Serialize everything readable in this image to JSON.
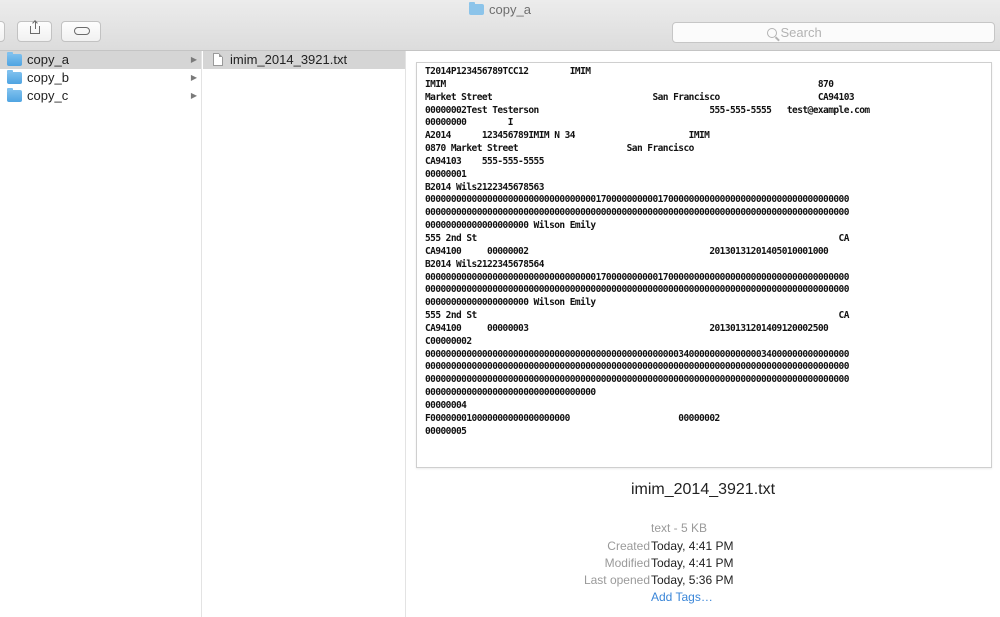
{
  "window": {
    "title": "copy_a"
  },
  "toolbar": {
    "search_placeholder": "Search"
  },
  "colors": {
    "accent": "#3a86d8",
    "folder": "#5aaee8",
    "selection": "#d5d5d5"
  },
  "sidebar": {
    "items": [
      {
        "label": "copy_a",
        "icon": "folder-icon",
        "selected": true
      },
      {
        "label": "copy_b",
        "icon": "folder-icon",
        "selected": false
      },
      {
        "label": "copy_c",
        "icon": "folder-icon",
        "selected": false
      }
    ]
  },
  "files": {
    "items": [
      {
        "label": "imim_2014_3921.txt",
        "icon": "text-file-icon"
      }
    ]
  },
  "preview": {
    "text": "T2014P123456789TCC12        IMIM\nIMIM                                                                        870\nMarket Street                               San Francisco                   CA94103\n00000002Test Testerson                                 555-555-5555   test@example.com\n00000000        I\nA2014      123456789IMIM N 34                      IMIM\n0870 Market Street                     San Francisco\nCA94103    555-555-5555\n00000001\nB2014 Wils2122345678563\n0000000000000000000000000000000001700000000001700000000000000000000000000000000000\n0000000000000000000000000000000000000000000000000000000000000000000000000000000000\n00000000000000000000 Wilson Emily\n555 2nd St                                                                      CA\nCA94100     00000002                                   20130131201405010001000\nB2014 Wils2122345678564\n0000000000000000000000000000000001700000000001700000000000000000000000000000000000\n0000000000000000000000000000000000000000000000000000000000000000000000000000000000\n00000000000000000000 Wilson Emily\n555 2nd St                                                                      CA\nCA94100     00000003                                   20130131201409120002500\nC00000002\n0000000000000000000000000000000000000000000000000340000000000000034000000000000000\n0000000000000000000000000000000000000000000000000000000000000000000000000000000000\n0000000000000000000000000000000000000000000000000000000000000000000000000000000000\n000000000000000000000000000000000\n00000004\nF000000010000000000000000000                     00000002\n00000005",
    "file_name": "imim_2014_3921.txt",
    "kind": "text - 5 KB",
    "created_label": "Created",
    "created_value": "Today, 4:41 PM",
    "modified_label": "Modified",
    "modified_value": "Today, 4:41 PM",
    "last_opened_label": "Last opened",
    "last_opened_value": "Today, 5:36 PM",
    "add_tags": "Add Tags…"
  }
}
